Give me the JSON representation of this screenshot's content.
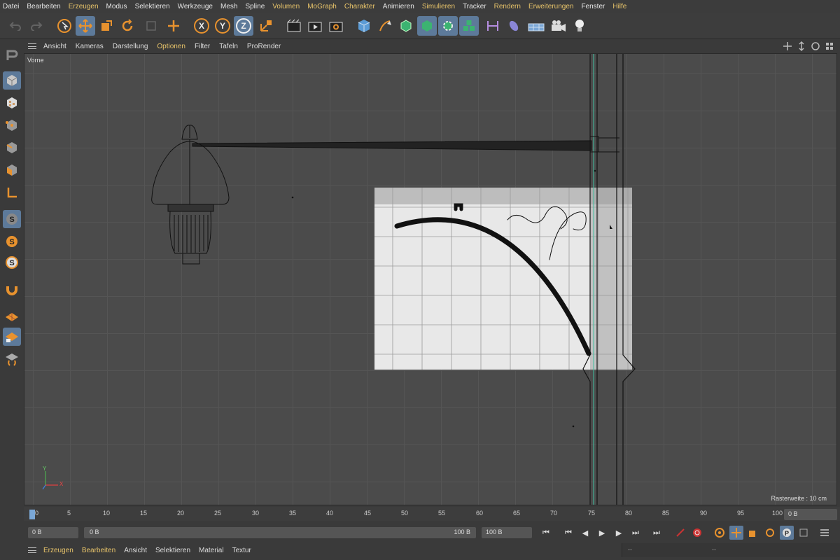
{
  "menubar": {
    "items": [
      {
        "label": "Datei",
        "accent": false
      },
      {
        "label": "Bearbeiten",
        "accent": false
      },
      {
        "label": "Erzeugen",
        "accent": true
      },
      {
        "label": "Modus",
        "accent": false
      },
      {
        "label": "Selektieren",
        "accent": false
      },
      {
        "label": "Werkzeuge",
        "accent": false
      },
      {
        "label": "Mesh",
        "accent": false
      },
      {
        "label": "Spline",
        "accent": false
      },
      {
        "label": "Volumen",
        "accent": true
      },
      {
        "label": "MoGraph",
        "accent": true
      },
      {
        "label": "Charakter",
        "accent": true
      },
      {
        "label": "Animieren",
        "accent": false
      },
      {
        "label": "Simulieren",
        "accent": true
      },
      {
        "label": "Tracker",
        "accent": false
      },
      {
        "label": "Rendern",
        "accent": true
      },
      {
        "label": "Erweiterungen",
        "accent": true
      },
      {
        "label": "Fenster",
        "accent": false
      },
      {
        "label": "Hilfe",
        "accent": true
      }
    ]
  },
  "toolbar": {
    "axis_x": "X",
    "axis_y": "Y",
    "axis_z": "Z"
  },
  "viewport_menu": {
    "items": [
      "Ansicht",
      "Kameras",
      "Darstellung",
      "Optionen",
      "Filter",
      "Tafeln",
      "ProRender"
    ],
    "active": "Optionen"
  },
  "viewport": {
    "name": "Vorne",
    "grid_info": "Rasterweite : 10 cm",
    "axis_y": "Y",
    "axis_x": "X"
  },
  "timeline": {
    "ticks": [
      "0",
      "5",
      "10",
      "15",
      "20",
      "25",
      "30",
      "35",
      "40",
      "45",
      "50",
      "55",
      "60",
      "65",
      "70",
      "75",
      "80",
      "85",
      "90",
      "95",
      "100"
    ],
    "current_frame": "0 B"
  },
  "playback": {
    "start": "0 B",
    "range_end": "100 B",
    "end": "100 B"
  },
  "bottom_menu": {
    "items": [
      "Erzeugen",
      "Bearbeiten",
      "Ansicht",
      "Selektieren",
      "Material",
      "Textur"
    ],
    "accent": [
      "Erzeugen",
      "Bearbeiten"
    ]
  },
  "bottom_right": {
    "left": "--",
    "right": "--"
  },
  "colors": {
    "accent_yellow": "#e8c46a",
    "selected_blue": "#5d7a9a",
    "orange": "#e8922e"
  }
}
